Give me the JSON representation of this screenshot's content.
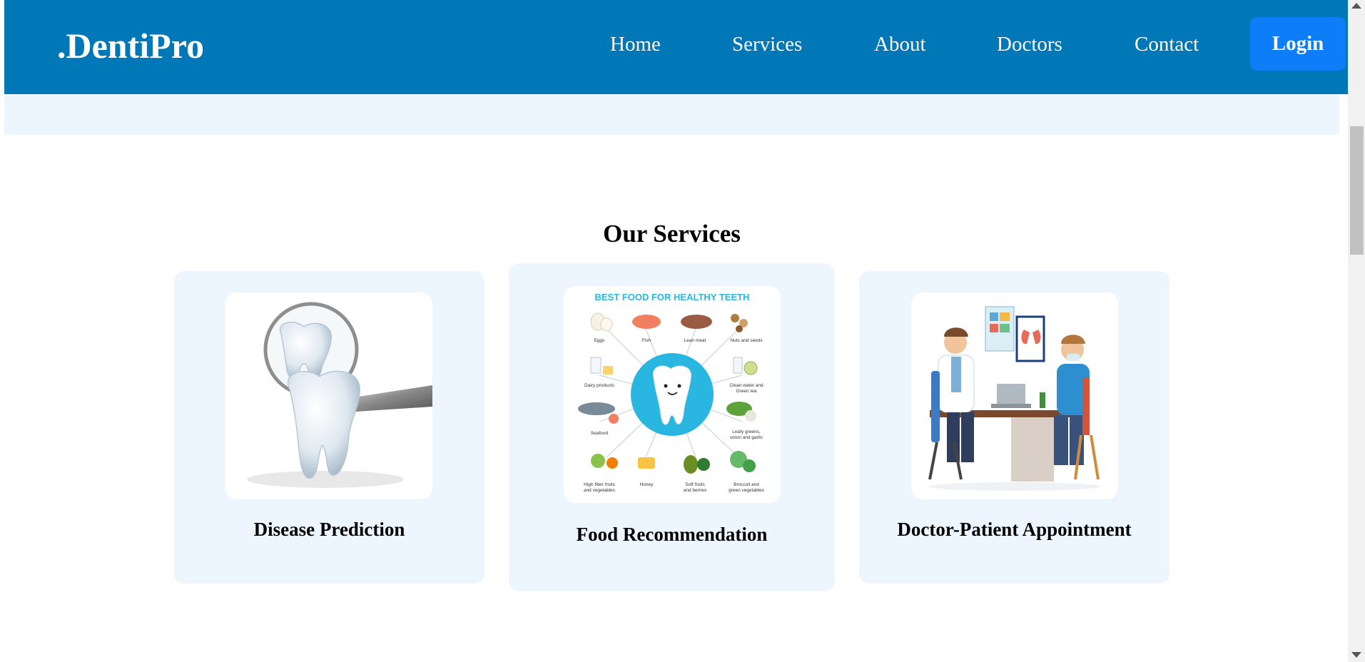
{
  "brand": ".DentiPro",
  "nav": {
    "items": [
      "Home",
      "Services",
      "About",
      "Doctors",
      "Contact"
    ],
    "login": "Login"
  },
  "services": {
    "title": "Our Services",
    "cards": [
      {
        "title": "Disease Prediction",
        "icon": "tooth-magnifier-image"
      },
      {
        "title": "Food Recommendation",
        "icon": "healthy-teeth-food-infographic",
        "infographic": {
          "heading": "BEST FOOD FOR HEALTHY TEETH",
          "labels": [
            "Eggs",
            "Fish",
            "Lean meat",
            "Nuts and seeds",
            "Dairy products",
            "Clean water and",
            "Green tea",
            "Seafood",
            "Leafy greens,",
            "onion and garlic",
            "High fiber fruits",
            "and vegetables",
            "Honey",
            "Soft fruits",
            "and berries",
            "Broccoli and",
            "green vegetables"
          ]
        }
      },
      {
        "title": "Doctor-Patient Appointment",
        "icon": "doctor-patient-illustration"
      }
    ]
  },
  "colors": {
    "navbar": "#0077b6",
    "login_button": "#0d7ef7",
    "card_background": "#edf5ff",
    "infographic_accent": "#29b6e0"
  }
}
